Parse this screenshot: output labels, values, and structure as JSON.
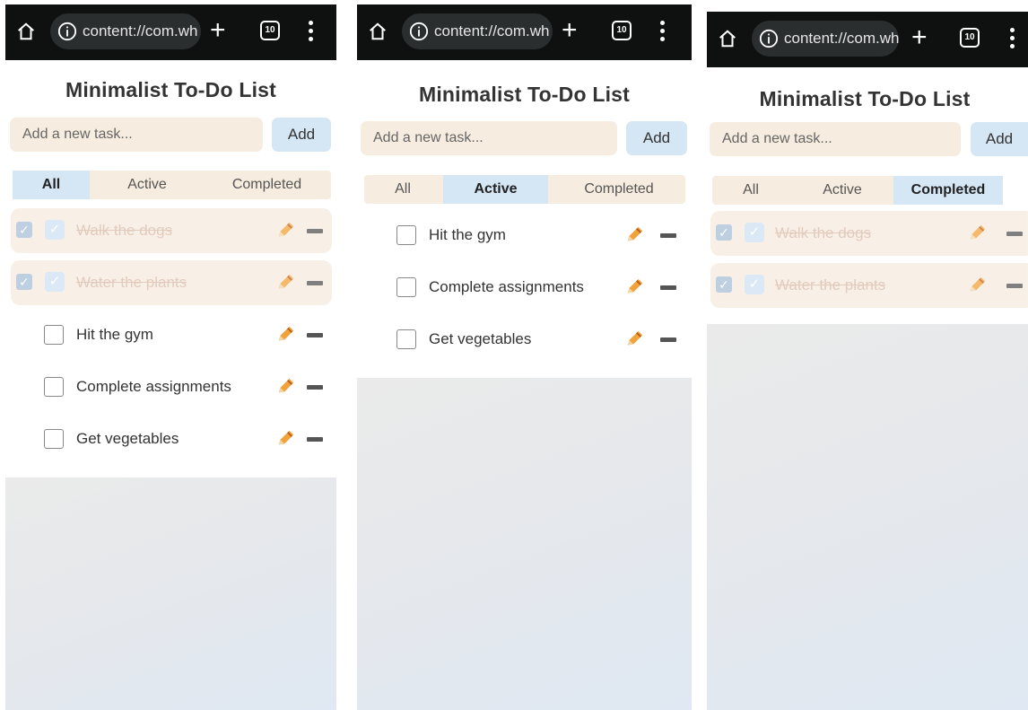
{
  "browser": {
    "url": "content://com.wh",
    "tab_count": "10",
    "plus": "+"
  },
  "app": {
    "title": "Minimalist To-Do List",
    "input_placeholder": "Add a new task...",
    "add_label": "Add",
    "filters": [
      "All",
      "Active",
      "Completed"
    ]
  },
  "panels": [
    {
      "selected_filter": "All",
      "tasks": [
        {
          "label": "Walk the dogs",
          "completed": true
        },
        {
          "label": "Water the plants",
          "completed": true
        },
        {
          "label": "Hit the gym",
          "completed": false
        },
        {
          "label": "Complete assignments",
          "completed": false
        },
        {
          "label": "Get vegetables",
          "completed": false
        }
      ]
    },
    {
      "selected_filter": "Active",
      "tasks": [
        {
          "label": "Hit the gym",
          "completed": false
        },
        {
          "label": "Complete assignments",
          "completed": false
        },
        {
          "label": "Get vegetables",
          "completed": false
        }
      ]
    },
    {
      "selected_filter": "Completed",
      "tasks": [
        {
          "label": "Walk the dogs",
          "completed": true
        },
        {
          "label": "Water the plants",
          "completed": true
        }
      ]
    }
  ],
  "colors": {
    "chrome_bg": "#0f1111",
    "input_bg": "#f6ecdf",
    "accent_blue": "#d5e6f5",
    "completed_text": "#d9b9a8"
  }
}
